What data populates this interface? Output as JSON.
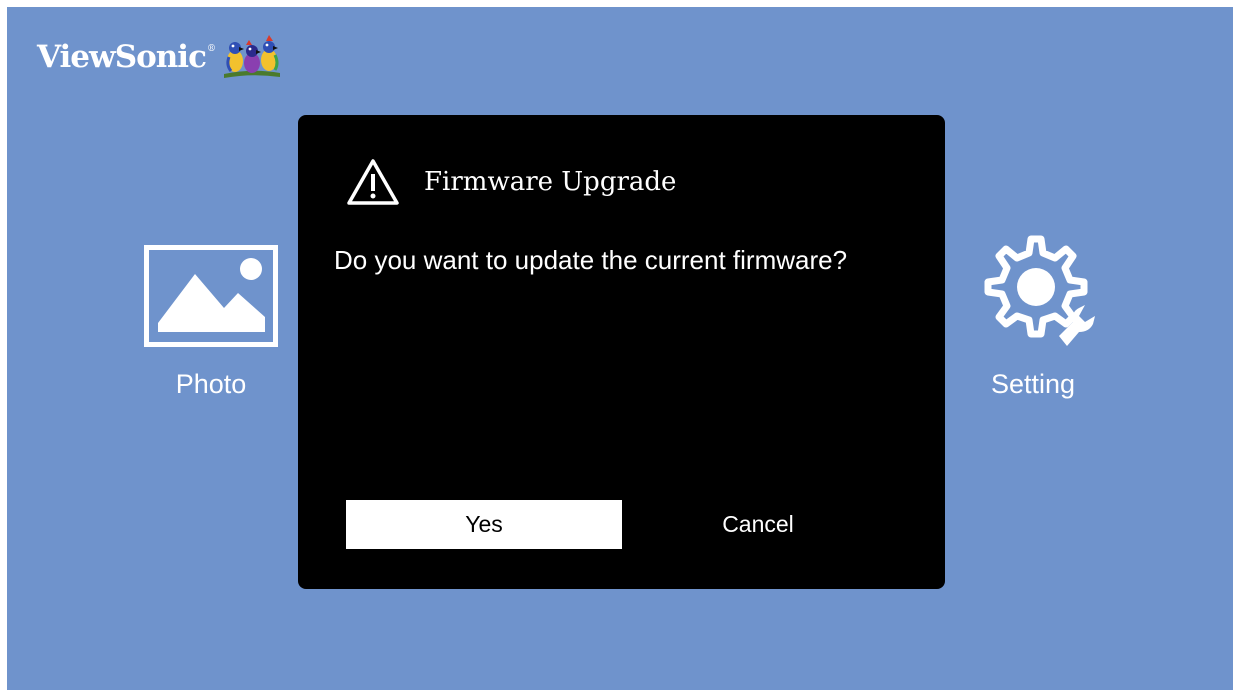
{
  "brand": {
    "name": "ViewSonic",
    "registered_mark": "®",
    "logo_icon": "viewsonic-birds-logo"
  },
  "apps": [
    {
      "label": "Photo",
      "icon": "photo-icon"
    },
    {
      "label": "Setting",
      "icon": "gear-wrench-icon"
    }
  ],
  "dialog": {
    "icon": "warning-icon",
    "title": "Firmware Upgrade",
    "message": "Do you want to update the current firmware?",
    "buttons": {
      "yes": "Yes",
      "cancel": "Cancel"
    },
    "focused_button": "yes"
  },
  "colors": {
    "background": "#6f93cc",
    "dialog_background": "#000000",
    "text": "#ffffff",
    "focused_button_background": "#ffffff",
    "focused_button_text": "#000000"
  }
}
